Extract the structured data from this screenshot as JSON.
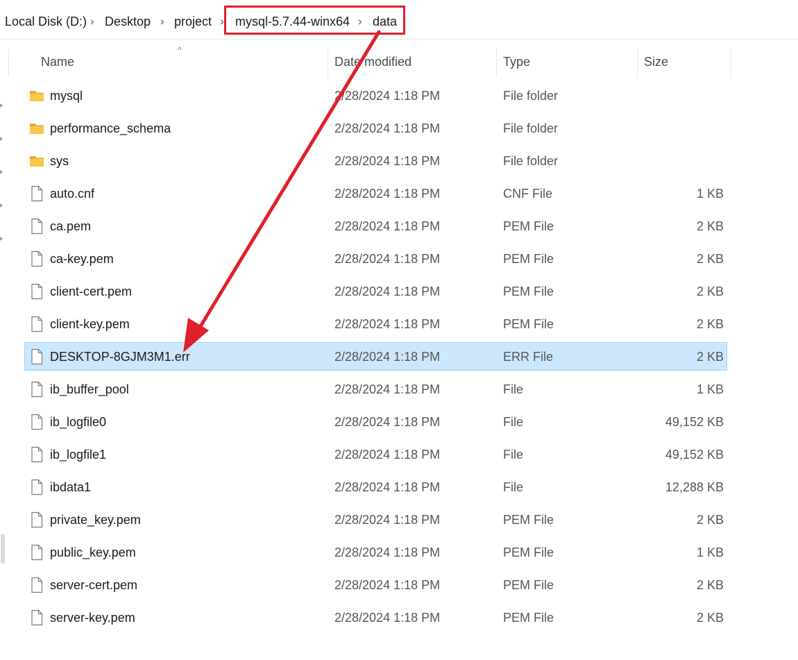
{
  "breadcrumb": {
    "items": [
      "Local Disk (D:)",
      "Desktop",
      "project",
      "mysql-5.7.44-winx64",
      "data"
    ],
    "separator": "›"
  },
  "columns": {
    "name": "Name",
    "date": "Date modified",
    "type": "Type",
    "size": "Size"
  },
  "sort_indicator": "^",
  "files": [
    {
      "name": "mysql",
      "date": "2/28/2024 1:18 PM",
      "type": "File folder",
      "size": "",
      "icon": "folder-icon"
    },
    {
      "name": "performance_schema",
      "date": "2/28/2024 1:18 PM",
      "type": "File folder",
      "size": "",
      "icon": "folder-icon"
    },
    {
      "name": "sys",
      "date": "2/28/2024 1:18 PM",
      "type": "File folder",
      "size": "",
      "icon": "folder-icon"
    },
    {
      "name": "auto.cnf",
      "date": "2/28/2024 1:18 PM",
      "type": "CNF File",
      "size": "1 KB",
      "icon": "file-icon"
    },
    {
      "name": "ca.pem",
      "date": "2/28/2024 1:18 PM",
      "type": "PEM File",
      "size": "2 KB",
      "icon": "file-icon"
    },
    {
      "name": "ca-key.pem",
      "date": "2/28/2024 1:18 PM",
      "type": "PEM File",
      "size": "2 KB",
      "icon": "file-icon"
    },
    {
      "name": "client-cert.pem",
      "date": "2/28/2024 1:18 PM",
      "type": "PEM File",
      "size": "2 KB",
      "icon": "file-icon"
    },
    {
      "name": "client-key.pem",
      "date": "2/28/2024 1:18 PM",
      "type": "PEM File",
      "size": "2 KB",
      "icon": "file-icon"
    },
    {
      "name": "DESKTOP-8GJM3M1.err",
      "date": "2/28/2024 1:18 PM",
      "type": "ERR File",
      "size": "2 KB",
      "icon": "file-icon",
      "selected": true
    },
    {
      "name": "ib_buffer_pool",
      "date": "2/28/2024 1:18 PM",
      "type": "File",
      "size": "1 KB",
      "icon": "file-icon"
    },
    {
      "name": "ib_logfile0",
      "date": "2/28/2024 1:18 PM",
      "type": "File",
      "size": "49,152 KB",
      "icon": "file-icon"
    },
    {
      "name": "ib_logfile1",
      "date": "2/28/2024 1:18 PM",
      "type": "File",
      "size": "49,152 KB",
      "icon": "file-icon"
    },
    {
      "name": "ibdata1",
      "date": "2/28/2024 1:18 PM",
      "type": "File",
      "size": "12,288 KB",
      "icon": "file-icon"
    },
    {
      "name": "private_key.pem",
      "date": "2/28/2024 1:18 PM",
      "type": "PEM File",
      "size": "2 KB",
      "icon": "file-icon"
    },
    {
      "name": "public_key.pem",
      "date": "2/28/2024 1:18 PM",
      "type": "PEM File",
      "size": "1 KB",
      "icon": "file-icon"
    },
    {
      "name": "server-cert.pem",
      "date": "2/28/2024 1:18 PM",
      "type": "PEM File",
      "size": "2 KB",
      "icon": "file-icon"
    },
    {
      "name": "server-key.pem",
      "date": "2/28/2024 1:18 PM",
      "type": "PEM File",
      "size": "2 KB",
      "icon": "file-icon"
    }
  ],
  "colors": {
    "annotation": "#e0202a",
    "selection_bg": "#cce8ff",
    "selection_border": "#99d1ff",
    "folder": "#f8c84a"
  }
}
